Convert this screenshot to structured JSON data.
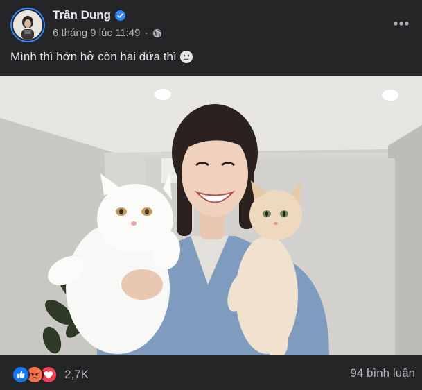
{
  "post": {
    "author": {
      "name": "Trần Dung",
      "verified": true,
      "avatar_icon": "profile-photo"
    },
    "timestamp": "6 tháng 9 lúc 11:49",
    "audience_icon": "globe-icon",
    "menu_icon": "more-horizontal-icon",
    "caption": {
      "text": "Mình thì hớn hở còn hai đứa thì",
      "emoji": "neutral-face-emoji"
    },
    "photo": {
      "icon": "photo-woman-with-two-cats"
    },
    "reactions": {
      "types": [
        "like",
        "angry",
        "love"
      ],
      "count": "2,7K"
    },
    "comments": {
      "label": "94 bình luận"
    }
  },
  "colors": {
    "background": "#242526",
    "text_primary": "#e4e6eb",
    "text_secondary": "#b0b3b8",
    "verified_blue": "#2d88ff",
    "like_blue": "#1877f2",
    "angry_orange": "#f7714c",
    "love_red": "#f33e58"
  }
}
